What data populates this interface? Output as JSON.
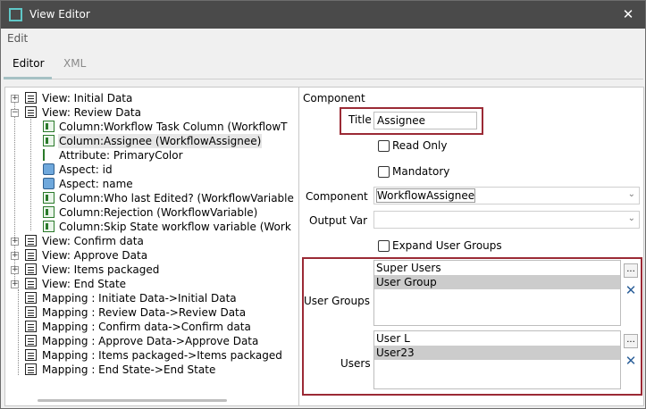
{
  "window": {
    "title": "View Editor"
  },
  "menu": {
    "edit": "Edit"
  },
  "tabs": {
    "editor": "Editor",
    "xml": "XML"
  },
  "tree": {
    "items": [
      {
        "text": "View: Initial Data"
      },
      {
        "text": "View: Review Data"
      },
      {
        "text": "Column:Workflow Task Column (WorkflowT"
      },
      {
        "text": "Column:Assignee (WorkflowAssignee)"
      },
      {
        "text": "Attribute: PrimaryColor"
      },
      {
        "text": "Aspect: id"
      },
      {
        "text": "Aspect: name"
      },
      {
        "text": "Column:Who last Edited? (WorkflowVariable"
      },
      {
        "text": "Column:Rejection (WorkflowVariable)"
      },
      {
        "text": "Column:Skip State workflow variable (Work"
      },
      {
        "text": "View: Confirm data"
      },
      {
        "text": "View: Approve Data"
      },
      {
        "text": "View: Items packaged"
      },
      {
        "text": "View: End State"
      },
      {
        "text": "Mapping : Initiate Data->Initial Data"
      },
      {
        "text": "Mapping : Review Data->Review Data"
      },
      {
        "text": "Mapping : Confirm data->Confirm data"
      },
      {
        "text": "Mapping : Approve Data->Approve Data"
      },
      {
        "text": "Mapping : Items packaged->Items packaged"
      },
      {
        "text": "Mapping : End State->End State"
      }
    ]
  },
  "props": {
    "section": "Component",
    "title_label": "Title",
    "title_value": "Assignee",
    "read_only": "Read Only",
    "mandatory": "Mandatory",
    "component_label": "Component",
    "component_value": "WorkflowAssignee",
    "output_var_label": "Output Var",
    "output_var_value": "",
    "expand_user_groups": "Expand User Groups",
    "user_groups_label": "User Groups",
    "user_groups": [
      "Super Users",
      "User Group"
    ],
    "users_label": "Users",
    "users": [
      "User L",
      "User23"
    ],
    "browse_label": "...",
    "accent_color": "#9b2a35"
  }
}
